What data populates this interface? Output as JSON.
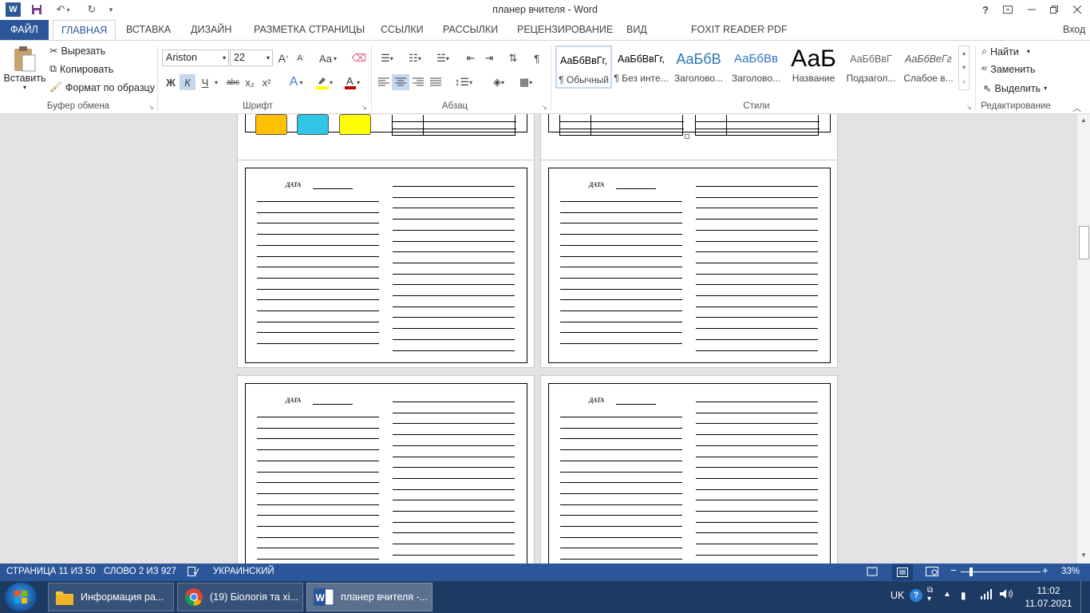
{
  "window": {
    "title": "планер вчителя - Word",
    "help": "?",
    "app_icon": "W"
  },
  "tabs": {
    "file": "ФАЙЛ",
    "items": [
      "ГЛАВНАЯ",
      "ВСТАВКА",
      "ДИЗАЙН",
      "РАЗМЕТКА СТРАНИЦЫ",
      "ССЫЛКИ",
      "РАССЫЛКИ",
      "РЕЦЕНЗИРОВАНИЕ",
      "ВИД",
      "FOXIT READER PDF"
    ],
    "signin": "Вход"
  },
  "clipboard": {
    "paste": "Вставить",
    "cut": "Вырезать",
    "copy": "Копировать",
    "format_painter": "Формат по образцу",
    "label": "Буфер обмена"
  },
  "font": {
    "name": "Ariston",
    "size": "22",
    "grow": "A",
    "shrink": "A",
    "case": "Aa",
    "bold": "Ж",
    "italic": "К",
    "underline": "Ч",
    "strike": "abc",
    "sub": "x₂",
    "sup": "x²",
    "label": "Шрифт"
  },
  "paragraph": {
    "label": "Абзац",
    "pilcrow": "¶"
  },
  "styles": {
    "label": "Стили",
    "items": [
      {
        "sample": "АаБбВвГг,",
        "name": "¶ Обычный"
      },
      {
        "sample": "АаБбВвГг,",
        "name": "¶ Без инте..."
      },
      {
        "sample": "АаБбВ",
        "name": "Заголово..."
      },
      {
        "sample": "АаБбВв",
        "name": "Заголово..."
      },
      {
        "sample": "АаБ",
        "name": "Название"
      },
      {
        "sample": "АаБбВвГ",
        "name": "Подзагол..."
      },
      {
        "sample": "АаБбВеГг",
        "name": "Слабое в..."
      }
    ]
  },
  "editing": {
    "find": "Найти",
    "replace": "Заменить",
    "select": "Выделить",
    "label": "Редактирование"
  },
  "document": {
    "date_label": "ДАТА",
    "swatch_colors": [
      "#ffc000",
      "#31c5e8",
      "#ffff00"
    ]
  },
  "status": {
    "page": "СТРАНИЦА 11 ИЗ 50",
    "words": "СЛОВО 2 ИЗ 927",
    "language": "УКРАИНСКИЙ",
    "zoom": "33%",
    "zoom_fraction": 0.33
  },
  "taskbar": {
    "items": [
      {
        "label": "Информация ра...",
        "icon": "folder-icon"
      },
      {
        "label": "(19) Біологія та хі...",
        "icon": "chrome-icon"
      },
      {
        "label": "планер вчителя -...",
        "icon": "word-icon"
      }
    ],
    "lang": "UK",
    "time": "11:02",
    "date": "11.07.2021"
  }
}
